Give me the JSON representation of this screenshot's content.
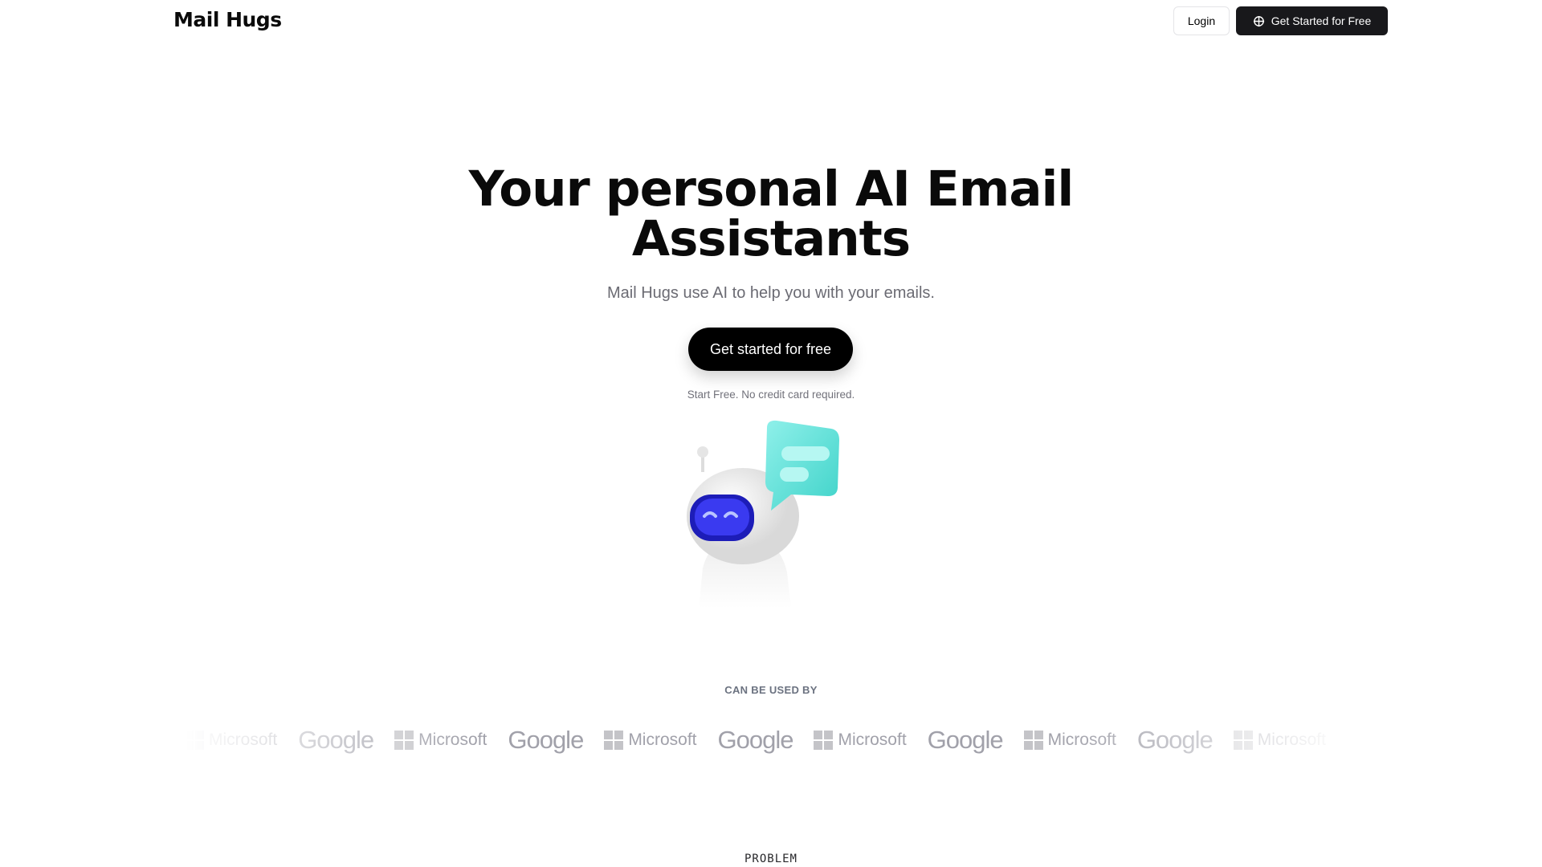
{
  "header": {
    "brand": "Mail Hugs",
    "login_label": "Login",
    "cta_label": "Get Started for Free",
    "cta_icon": "crosshair-icon"
  },
  "hero": {
    "title_line1": "Your personal AI Email",
    "title_line2": "Assistants",
    "subtitle": "Mail Hugs use AI to help you with your emails.",
    "cta_label": "Get started for free",
    "note": "Start Free. No credit card required."
  },
  "used_by": {
    "label": "CAN BE USED BY",
    "logos": [
      "Microsoft",
      "Google",
      "Microsoft",
      "Google",
      "Microsoft",
      "Google",
      "Microsoft",
      "Google",
      "Microsoft",
      "Google",
      "Microsoft",
      "Google",
      "Microsoft"
    ]
  },
  "next_section": {
    "label": "PROBLEM"
  },
  "colors": {
    "primary": "#18181b",
    "robot_visor": "#2a2ae0",
    "bubble": "#5ee0d8"
  }
}
